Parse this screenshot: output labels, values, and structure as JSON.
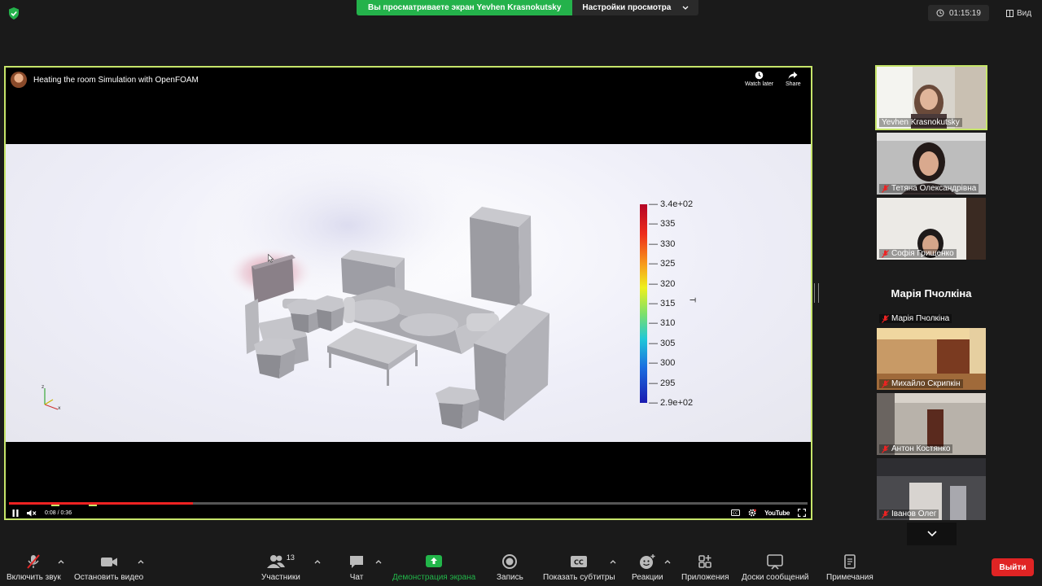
{
  "top_bar": {
    "banner_text": "Вы просматриваете экран Yevhen Krasnokutsky",
    "view_settings_label": "Настройки просмотра",
    "timer": "01:15:19",
    "view_label": "Вид"
  },
  "video": {
    "title": "Heating the room Simulation with OpenFOAM",
    "watch_later": "Watch later",
    "share": "Share",
    "time": "0:08 / 0:36",
    "youtube": "YouTube",
    "progress": 0.23
  },
  "simulation": {
    "colorbar_title": "T",
    "colorbar_labels": [
      "3.4e+02",
      "335",
      "330",
      "325",
      "320",
      "315",
      "310",
      "305",
      "300",
      "295",
      "2.9e+02"
    ]
  },
  "participants": [
    {
      "name": "Yevhen Krasnokutsky",
      "muted": false,
      "active": true
    },
    {
      "name": "Тетяна Олександрівна",
      "muted": true
    },
    {
      "name": "Софія Грищенко",
      "muted": true
    },
    {
      "name": "Марія Пчолкіна",
      "muted": true,
      "no_video": true
    },
    {
      "name": "Михайло Скрипкін",
      "muted": true
    },
    {
      "name": "Антон  Костянко",
      "muted": true
    },
    {
      "name": "Іванов Олег",
      "muted": true
    }
  ],
  "toolbar": {
    "unmute": "Включить звук",
    "stop_video": "Остановить видео",
    "participants": "Участники",
    "participants_count": "13",
    "chat": "Чат",
    "share_screen": "Демонстрация экрана",
    "record": "Запись",
    "captions": "Показать субтитры",
    "reactions": "Реакции",
    "apps": "Приложения",
    "whiteboards": "Доски сообщений",
    "notes": "Примечания",
    "leave": "Выйти"
  },
  "colors": {
    "accent_green": "#24b24b",
    "active_border": "#c6e56a",
    "leave_red": "#e02424"
  }
}
